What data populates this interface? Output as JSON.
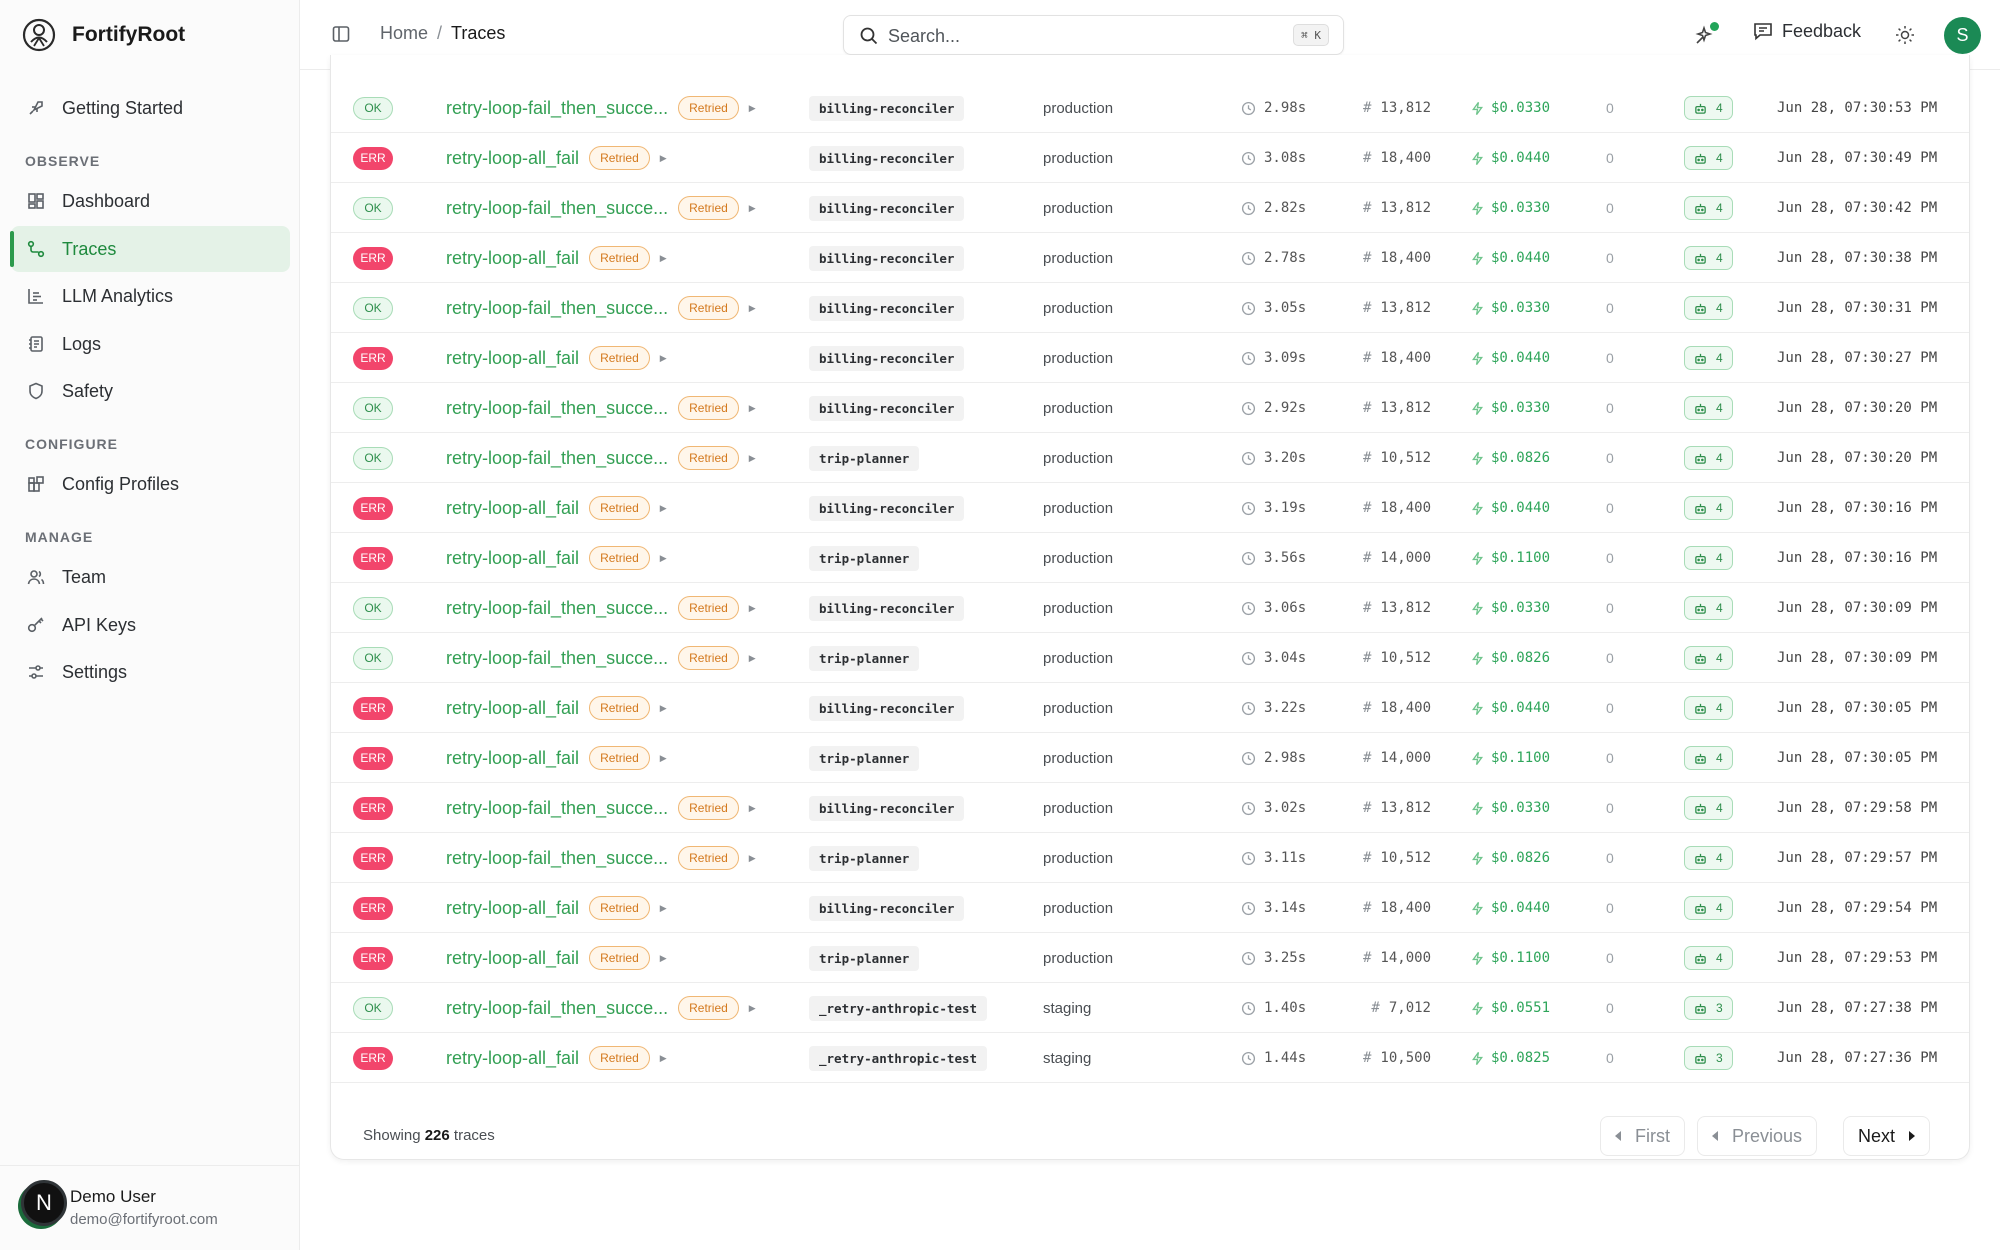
{
  "app": {
    "name": "FortifyRoot"
  },
  "sidebar": {
    "getting_started": "Getting Started",
    "sections": {
      "observe": "OBSERVE",
      "configure": "CONFIGURE",
      "manage": "MANAGE"
    },
    "items": {
      "dashboard": "Dashboard",
      "traces": "Traces",
      "llm_analytics": "LLM Analytics",
      "logs": "Logs",
      "safety": "Safety",
      "config_profiles": "Config Profiles",
      "team": "Team",
      "api_keys": "API Keys",
      "settings": "Settings"
    },
    "active": "traces",
    "user": {
      "initial": "N",
      "name": "Demo User",
      "email": "demo@fortifyroot.com"
    }
  },
  "header": {
    "breadcrumb": {
      "home": "Home",
      "separator": "/",
      "current": "Traces"
    },
    "search": {
      "placeholder": "Search...",
      "shortcut": "⌘ K"
    },
    "feedback_label": "Feedback",
    "avatar_initial": "S"
  },
  "traces": {
    "retried_label": "Retried",
    "rows": [
      {
        "status": "OK",
        "name": "retry-loop-fail_then_succe...",
        "service": "billing-reconciler",
        "env": "production",
        "duration": "2.98s",
        "tokens": "13,812",
        "cost": "$0.0330",
        "errors": "0",
        "spans": "4",
        "time": "Jun 28, 07:30:53 PM"
      },
      {
        "status": "ERR",
        "name": "retry-loop-all_fail",
        "service": "billing-reconciler",
        "env": "production",
        "duration": "3.08s",
        "tokens": "18,400",
        "cost": "$0.0440",
        "errors": "0",
        "spans": "4",
        "time": "Jun 28, 07:30:49 PM"
      },
      {
        "status": "OK",
        "name": "retry-loop-fail_then_succe...",
        "service": "billing-reconciler",
        "env": "production",
        "duration": "2.82s",
        "tokens": "13,812",
        "cost": "$0.0330",
        "errors": "0",
        "spans": "4",
        "time": "Jun 28, 07:30:42 PM"
      },
      {
        "status": "ERR",
        "name": "retry-loop-all_fail",
        "service": "billing-reconciler",
        "env": "production",
        "duration": "2.78s",
        "tokens": "18,400",
        "cost": "$0.0440",
        "errors": "0",
        "spans": "4",
        "time": "Jun 28, 07:30:38 PM"
      },
      {
        "status": "OK",
        "name": "retry-loop-fail_then_succe...",
        "service": "billing-reconciler",
        "env": "production",
        "duration": "3.05s",
        "tokens": "13,812",
        "cost": "$0.0330",
        "errors": "0",
        "spans": "4",
        "time": "Jun 28, 07:30:31 PM"
      },
      {
        "status": "ERR",
        "name": "retry-loop-all_fail",
        "service": "billing-reconciler",
        "env": "production",
        "duration": "3.09s",
        "tokens": "18,400",
        "cost": "$0.0440",
        "errors": "0",
        "spans": "4",
        "time": "Jun 28, 07:30:27 PM"
      },
      {
        "status": "OK",
        "name": "retry-loop-fail_then_succe...",
        "service": "billing-reconciler",
        "env": "production",
        "duration": "2.92s",
        "tokens": "13,812",
        "cost": "$0.0330",
        "errors": "0",
        "spans": "4",
        "time": "Jun 28, 07:30:20 PM"
      },
      {
        "status": "OK",
        "name": "retry-loop-fail_then_succe...",
        "service": "trip-planner",
        "env": "production",
        "duration": "3.20s",
        "tokens": "10,512",
        "cost": "$0.0826",
        "errors": "0",
        "spans": "4",
        "time": "Jun 28, 07:30:20 PM"
      },
      {
        "status": "ERR",
        "name": "retry-loop-all_fail",
        "service": "billing-reconciler",
        "env": "production",
        "duration": "3.19s",
        "tokens": "18,400",
        "cost": "$0.0440",
        "errors": "0",
        "spans": "4",
        "time": "Jun 28, 07:30:16 PM"
      },
      {
        "status": "ERR",
        "name": "retry-loop-all_fail",
        "service": "trip-planner",
        "env": "production",
        "duration": "3.56s",
        "tokens": "14,000",
        "cost": "$0.1100",
        "errors": "0",
        "spans": "4",
        "time": "Jun 28, 07:30:16 PM"
      },
      {
        "status": "OK",
        "name": "retry-loop-fail_then_succe...",
        "service": "billing-reconciler",
        "env": "production",
        "duration": "3.06s",
        "tokens": "13,812",
        "cost": "$0.0330",
        "errors": "0",
        "spans": "4",
        "time": "Jun 28, 07:30:09 PM"
      },
      {
        "status": "OK",
        "name": "retry-loop-fail_then_succe...",
        "service": "trip-planner",
        "env": "production",
        "duration": "3.04s",
        "tokens": "10,512",
        "cost": "$0.0826",
        "errors": "0",
        "spans": "4",
        "time": "Jun 28, 07:30:09 PM"
      },
      {
        "status": "ERR",
        "name": "retry-loop-all_fail",
        "service": "billing-reconciler",
        "env": "production",
        "duration": "3.22s",
        "tokens": "18,400",
        "cost": "$0.0440",
        "errors": "0",
        "spans": "4",
        "time": "Jun 28, 07:30:05 PM"
      },
      {
        "status": "ERR",
        "name": "retry-loop-all_fail",
        "service": "trip-planner",
        "env": "production",
        "duration": "2.98s",
        "tokens": "14,000",
        "cost": "$0.1100",
        "errors": "0",
        "spans": "4",
        "time": "Jun 28, 07:30:05 PM"
      },
      {
        "status": "ERR",
        "name": "retry-loop-fail_then_succe...",
        "service": "billing-reconciler",
        "env": "production",
        "duration": "3.02s",
        "tokens": "13,812",
        "cost": "$0.0330",
        "errors": "0",
        "spans": "4",
        "time": "Jun 28, 07:29:58 PM"
      },
      {
        "status": "ERR",
        "name": "retry-loop-fail_then_succe...",
        "service": "trip-planner",
        "env": "production",
        "duration": "3.11s",
        "tokens": "10,512",
        "cost": "$0.0826",
        "errors": "0",
        "spans": "4",
        "time": "Jun 28, 07:29:57 PM"
      },
      {
        "status": "ERR",
        "name": "retry-loop-all_fail",
        "service": "billing-reconciler",
        "env": "production",
        "duration": "3.14s",
        "tokens": "18,400",
        "cost": "$0.0440",
        "errors": "0",
        "spans": "4",
        "time": "Jun 28, 07:29:54 PM"
      },
      {
        "status": "ERR",
        "name": "retry-loop-all_fail",
        "service": "trip-planner",
        "env": "production",
        "duration": "3.25s",
        "tokens": "14,000",
        "cost": "$0.1100",
        "errors": "0",
        "spans": "4",
        "time": "Jun 28, 07:29:53 PM"
      },
      {
        "status": "OK",
        "name": "retry-loop-fail_then_succe...",
        "service": "_retry-anthropic-test",
        "env": "staging",
        "duration": "1.40s",
        "tokens": "7,012",
        "cost": "$0.0551",
        "errors": "0",
        "spans": "3",
        "time": "Jun 28, 07:27:38 PM"
      },
      {
        "status": "ERR",
        "name": "retry-loop-all_fail",
        "service": "_retry-anthropic-test",
        "env": "staging",
        "duration": "1.44s",
        "tokens": "10,500",
        "cost": "$0.0825",
        "errors": "0",
        "spans": "3",
        "time": "Jun 28, 07:27:36 PM"
      }
    ]
  },
  "footer": {
    "showing_prefix": "Showing",
    "count": "226",
    "showing_suffix": "traces",
    "first": "First",
    "previous": "Previous",
    "next": "Next"
  },
  "colors": {
    "accent": "#2c9a4c",
    "err": "#f2456b",
    "retried": "#d4791e"
  },
  "icons": [
    "logo-icon",
    "rocket-icon",
    "dashboard-icon",
    "traces-icon",
    "chart-icon",
    "logs-icon",
    "shield-icon",
    "config-icon",
    "team-icon",
    "key-icon",
    "sliders-icon",
    "sidebar-toggle-icon",
    "search-icon",
    "sparkle-icon",
    "feedback-icon",
    "sun-icon",
    "clock-icon",
    "hash-icon",
    "bolt-icon",
    "robot-icon",
    "chevron-left-icon",
    "chevron-right-icon"
  ]
}
